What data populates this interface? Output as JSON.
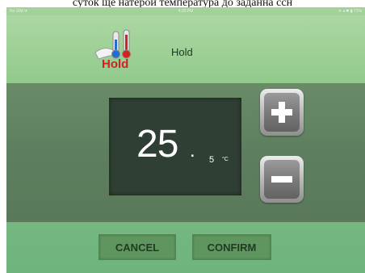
{
  "caption": "суток ще натерой температура до заданна ссн",
  "statusbar": {
    "left": "No SIM ✈",
    "center": "4:20 PM",
    "right": "✈ ◂ ✱ ▮ 71%"
  },
  "header": {
    "icon_label": "Hold",
    "mode_title": "Hold"
  },
  "temperature": {
    "integer": "25",
    "dot": ".",
    "decimal": "5",
    "unit": "°C"
  },
  "controls": {
    "increase_icon": "plus-icon",
    "decrease_icon": "minus-icon"
  },
  "actions": {
    "cancel": "CANCEL",
    "confirm": "CONFIRM"
  },
  "colors": {
    "background": "#8cc589",
    "band": "#5e7f5f",
    "display": "#2f3f33",
    "button": "#5f965f",
    "hold_text": "#d21f1f"
  }
}
